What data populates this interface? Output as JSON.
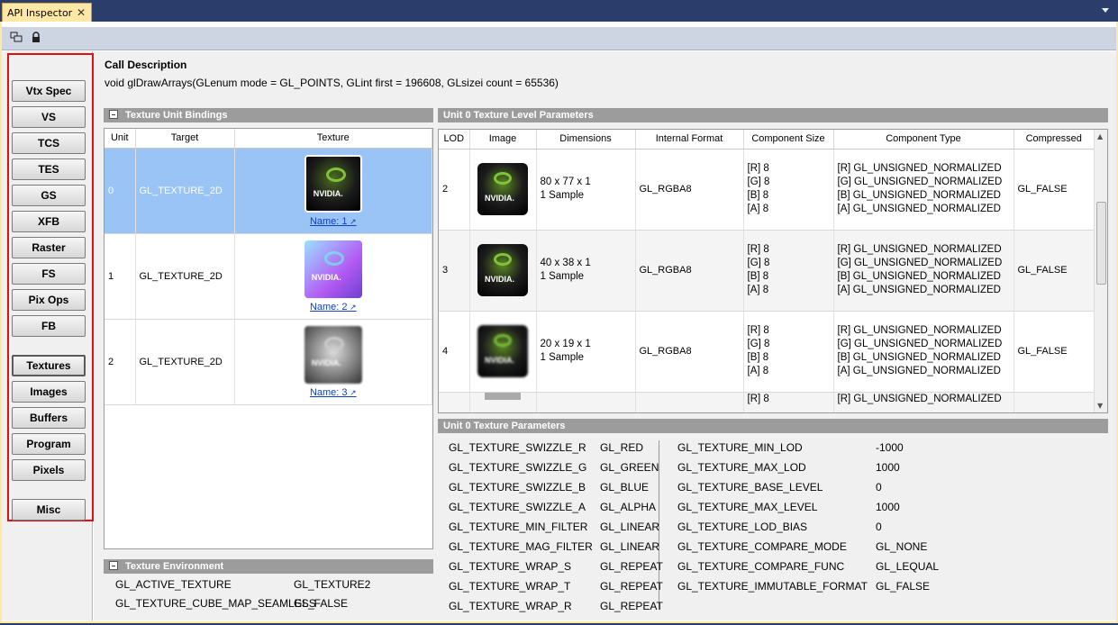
{
  "window": {
    "tab_title": "API Inspector",
    "close_glyph": "✕"
  },
  "toolbar": {
    "icons": [
      "windows-icon",
      "lock-icon"
    ]
  },
  "nav": {
    "buttons": [
      "Vtx Spec",
      "VS",
      "TCS",
      "TES",
      "GS",
      "XFB",
      "Raster",
      "FS",
      "Pix Ops",
      "FB",
      "Textures",
      "Images",
      "Buffers",
      "Program",
      "Pixels",
      "Misc"
    ],
    "active": "Textures"
  },
  "call": {
    "title": "Call Description",
    "text": "void glDrawArrays(GLenum mode = GL_POINTS, GLint first = 196608, GLsizei count = 65536)"
  },
  "bindings": {
    "title": "Texture Unit Bindings",
    "headers": [
      "Unit",
      "Target",
      "Texture"
    ],
    "rows": [
      {
        "unit": "0",
        "target": "GL_TEXTURE_2D",
        "name": "Name: 1"
      },
      {
        "unit": "1",
        "target": "GL_TEXTURE_2D",
        "name": "Name: 2"
      },
      {
        "unit": "2",
        "target": "GL_TEXTURE_2D",
        "name": "Name: 3"
      }
    ]
  },
  "levels": {
    "title": "Unit 0 Texture Level Parameters",
    "headers": [
      "LOD",
      "Image",
      "Dimensions",
      "Internal Format",
      "Component Size",
      "Component Type",
      "Compressed"
    ],
    "rows": [
      {
        "lod": "2",
        "dim1": "80 x 77 x 1",
        "dim2": "1 Sample",
        "fmt": "GL_RGBA8",
        "sizes": [
          "[R]  8",
          "[G]  8",
          "[B]  8",
          "[A]  8"
        ],
        "types": [
          "[R]  GL_UNSIGNED_NORMALIZED",
          "[G]  GL_UNSIGNED_NORMALIZED",
          "[B]  GL_UNSIGNED_NORMALIZED",
          "[A]  GL_UNSIGNED_NORMALIZED"
        ],
        "comp": "GL_FALSE"
      },
      {
        "lod": "3",
        "dim1": "40 x 38 x 1",
        "dim2": "1 Sample",
        "fmt": "GL_RGBA8",
        "sizes": [
          "[R]  8",
          "[G]  8",
          "[B]  8",
          "[A]  8"
        ],
        "types": [
          "[R]  GL_UNSIGNED_NORMALIZED",
          "[G]  GL_UNSIGNED_NORMALIZED",
          "[B]  GL_UNSIGNED_NORMALIZED",
          "[A]  GL_UNSIGNED_NORMALIZED"
        ],
        "comp": "GL_FALSE"
      },
      {
        "lod": "4",
        "dim1": "20 x 19 x 1",
        "dim2": "1 Sample",
        "fmt": "GL_RGBA8",
        "sizes": [
          "[R]  8",
          "[G]  8",
          "[B]  8",
          "[A]  8"
        ],
        "types": [
          "[R]  GL_UNSIGNED_NORMALIZED",
          "[G]  GL_UNSIGNED_NORMALIZED",
          "[B]  GL_UNSIGNED_NORMALIZED",
          "[A]  GL_UNSIGNED_NORMALIZED"
        ],
        "comp": "GL_FALSE"
      }
    ],
    "partial": {
      "size": "[R]  8",
      "type": "[R]  GL_UNSIGNED_NORMALIZED"
    }
  },
  "texparams": {
    "title": "Unit 0 Texture Parameters",
    "left": [
      [
        "GL_TEXTURE_SWIZZLE_R",
        "GL_RED"
      ],
      [
        "GL_TEXTURE_SWIZZLE_G",
        "GL_GREEN"
      ],
      [
        "GL_TEXTURE_SWIZZLE_B",
        "GL_BLUE"
      ],
      [
        "GL_TEXTURE_SWIZZLE_A",
        "GL_ALPHA"
      ],
      [
        "GL_TEXTURE_MIN_FILTER",
        "GL_LINEAR"
      ],
      [
        "GL_TEXTURE_MAG_FILTER",
        "GL_LINEAR"
      ],
      [
        "GL_TEXTURE_WRAP_S",
        "GL_REPEAT"
      ],
      [
        "GL_TEXTURE_WRAP_T",
        "GL_REPEAT"
      ],
      [
        "GL_TEXTURE_WRAP_R",
        "GL_REPEAT"
      ]
    ],
    "right": [
      [
        "GL_TEXTURE_MIN_LOD",
        "-1000"
      ],
      [
        "GL_TEXTURE_MAX_LOD",
        "1000"
      ],
      [
        "GL_TEXTURE_BASE_LEVEL",
        "0"
      ],
      [
        "GL_TEXTURE_MAX_LEVEL",
        "1000"
      ],
      [
        "GL_TEXTURE_LOD_BIAS",
        "0"
      ],
      [
        "GL_TEXTURE_COMPARE_MODE",
        "GL_NONE"
      ],
      [
        "GL_TEXTURE_COMPARE_FUNC",
        "GL_LEQUAL"
      ],
      [
        "GL_TEXTURE_IMMUTABLE_FORMAT",
        "GL_FALSE"
      ]
    ]
  },
  "env": {
    "title": "Texture Environment",
    "rows": [
      [
        "GL_ACTIVE_TEXTURE",
        "GL_TEXTURE2"
      ],
      [
        "GL_TEXTURE_CUBE_MAP_SEAMLESS",
        "GL_FALSE"
      ]
    ]
  },
  "colors": {
    "selection": "#99c4f5",
    "highlight_box": "#e01010",
    "header_gray": "#9c9c9c",
    "tab_yellow": "#ffe8a6"
  }
}
